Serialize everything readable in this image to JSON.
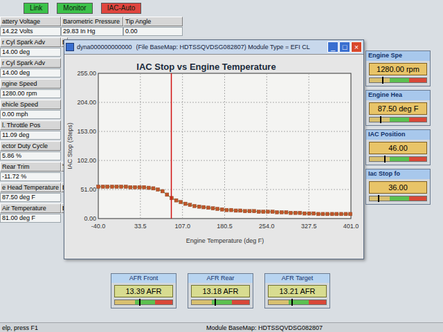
{
  "toolbar": [
    {
      "label": "Link",
      "color": "#3cc24a"
    },
    {
      "label": "Monitor",
      "color": "#3cc24a"
    },
    {
      "label": "IAC-Auto",
      "color": "#e0453f"
    }
  ],
  "gauge_rows": [
    [
      {
        "kind": "full",
        "label": "attery Voltage",
        "value": "14.22 Volts"
      },
      {
        "kind": "full",
        "label": "Barometric Pressure",
        "value": "29.83 In Hg"
      },
      {
        "kind": "full",
        "label": "Tip Angle",
        "value": "0.00"
      }
    ],
    [
      {
        "kind": "full",
        "label": "r Cyl Spark Adv",
        "value": "14.00 deg"
      },
      {
        "kind": "stub",
        "label": "B"
      }
    ],
    [
      {
        "kind": "full",
        "label": "r Cyl Spark Adv",
        "value": "14.00 deg"
      }
    ],
    [
      {
        "kind": "full",
        "label": "ngine Speed",
        "value": "1280.00 rpm"
      }
    ],
    [
      {
        "kind": "full",
        "label": "ehicle Speed",
        "value": "0.00 mph"
      }
    ],
    [
      {
        "kind": "full",
        "label": "l. Throttle Pos",
        "value": "11.09 deg"
      }
    ],
    [
      {
        "kind": "full",
        "label": "ector Duty Cycle",
        "value": "5.86 %"
      }
    ],
    [
      {
        "kind": "full",
        "label": "Rear Trim",
        "value": "-11.72 %"
      },
      {
        "kind": "stub",
        "label": "T"
      }
    ],
    [
      {
        "kind": "full",
        "label": "e Head Temperature",
        "value": "87.50 deg F"
      },
      {
        "kind": "stub",
        "label": "E"
      }
    ],
    [
      {
        "kind": "full",
        "label": "Air Temperature",
        "value": "81.00 deg F"
      },
      {
        "kind": "stub",
        "label": "B"
      }
    ]
  ],
  "window": {
    "title": "dyna000000000000",
    "subtitle": "(File BaseMap: HDTSSQVDSG082807)  Module Type = EFI CL",
    "controls": [
      {
        "glyph": "_",
        "kind": "normal"
      },
      {
        "glyph": "□",
        "kind": "normal"
      },
      {
        "glyph": "×",
        "kind": "close"
      }
    ]
  },
  "chart": {
    "title": "IAC Stop vs Engine Temperature",
    "y_label": "IAC Stop (Steps)",
    "x_label": "Engine Temperature (deg F)",
    "y_ticks": [
      "255.00",
      "204.00",
      "153.00",
      "102.00",
      "51.00",
      "0.00"
    ],
    "x_ticks": [
      "-40.0",
      "33.5",
      "107.0",
      "180.5",
      "254.0",
      "327.5",
      "401.0"
    ],
    "x_range": [
      -40,
      401
    ],
    "y_range": [
      0,
      255
    ],
    "cursor_temp": 87.5,
    "series": {
      "x_start": -40,
      "x_step": 8,
      "values": [
        56,
        56,
        56,
        56,
        56,
        56,
        56,
        55,
        55,
        55,
        55,
        54,
        53,
        51,
        48,
        42,
        36,
        32,
        29,
        26,
        24,
        22,
        21,
        20,
        19,
        18,
        17,
        16,
        15,
        15,
        14,
        14,
        13,
        13,
        13,
        12,
        12,
        12,
        12,
        11,
        11,
        11,
        10,
        10,
        10,
        9,
        9,
        9,
        8,
        8,
        8,
        8,
        8,
        8,
        8,
        8
      ]
    }
  },
  "side_gauges": [
    {
      "title": "Engine Spe",
      "value": "1280.00 rpm",
      "level": 0.22
    },
    {
      "title": "Engine Hea",
      "value": "87.50 deg F",
      "level": 0.18
    },
    {
      "title": "IAC Position",
      "value": "46.00",
      "level": 0.25
    },
    {
      "title": "Iac Stop fo",
      "value": "36.00",
      "level": 0.15
    }
  ],
  "afr_gauges": [
    {
      "title": "AFR Front",
      "value": "13.39 AFR",
      "level": 0.42
    },
    {
      "title": "AFR Rear",
      "value": "13.18 AFR",
      "level": 0.4
    },
    {
      "title": "AFR Target",
      "value": "13.21 AFR",
      "level": 0.4
    }
  ],
  "status_bar": {
    "help": "elp, press F1",
    "module": "Module BaseMap: HDTSSQVDSG082807"
  }
}
